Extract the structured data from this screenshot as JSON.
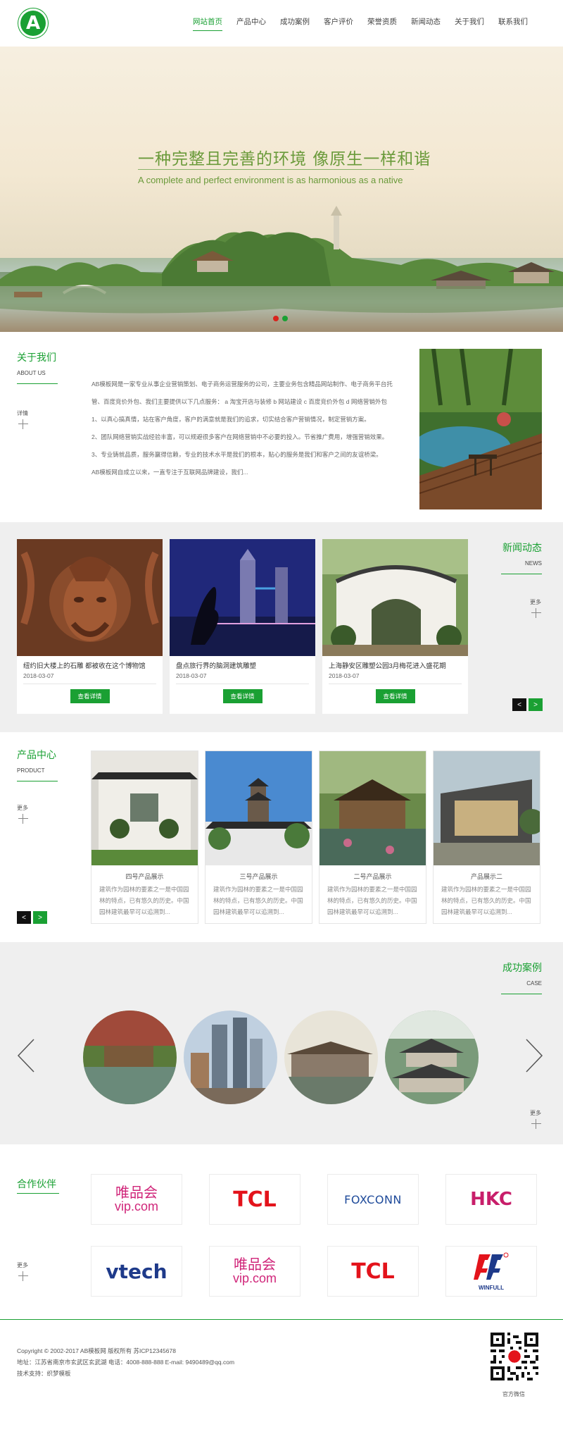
{
  "nav": {
    "logo_letter": "A",
    "items": [
      "网站首页",
      "产品中心",
      "成功案例",
      "客户评价",
      "荣誉资质",
      "新闻动态",
      "关于我们",
      "联系我们"
    ],
    "active_index": 0
  },
  "banner": {
    "title": "一种完整且完善的环境  像原生一样和谐",
    "subtitle": "A complete and perfect environment is as harmonious as a native",
    "dot_colors": [
      "#d8231c",
      "#1aa033"
    ]
  },
  "about": {
    "title_cn": "关于我们",
    "title_en": "ABOUT US",
    "more": "详情",
    "paragraphs": [
      "AB模板网是一家专业从事企业营销策划、电子商务运营服务的公司，主要业务包含精品网站制作、电子商务平台托管、百度竞价外包、我们主要提供以下几点服务： a 淘宝开店与装修 b 网站建设 c 百度竞价外包 d 网络营销外包 1、以真心搞真情，站在客户角度，客户的满意就是我们的追求，切实结合客户营销情况，制定营销方案。",
      "2、团队网络营销实战经验丰富，可以规避很多客户在网络营销中不必要的投入。节省推广费用，增强营销效果。",
      "3、专业铸就品质，服务赢得信赖，专业的技术水平是我们的根本，贴心的服务是我们和客户之间的友谊桥梁。",
      "AB模板网自成立以来，一直专注于互联网品牌建设，我们..."
    ]
  },
  "news": {
    "title_cn": "新闻动态",
    "title_en": "NEWS",
    "more": "更多",
    "button_label": "查看详情",
    "items": [
      {
        "title": "纽约旧大楼上的石雕 都被收在这个博物馆",
        "date": "2018-03-07"
      },
      {
        "title": "盘点旅行界的脑洞建筑雕塑",
        "date": "2018-03-07"
      },
      {
        "title": "上海静安区雕塑公园3月梅花进入盛花期",
        "date": "2018-03-07"
      }
    ],
    "prev": "<",
    "next": ">"
  },
  "products": {
    "title_cn": "产品中心",
    "title_en": "PRODUCT",
    "more": "更多",
    "prev": "<",
    "next": ">",
    "items": [
      {
        "title": "四号产品展示",
        "desc": "建筑作为园林的要素之一是中国园林的特点，已有悠久的历史。中国园林建筑最早可以追溯到..."
      },
      {
        "title": "三号产品展示",
        "desc": "建筑作为园林的要素之一是中国园林的特点，已有悠久的历史。中国园林建筑最早可以追溯到..."
      },
      {
        "title": "二号产品展示",
        "desc": "建筑作为园林的要素之一是中国园林的特点，已有悠久的历史。中国园林建筑最早可以追溯到..."
      },
      {
        "title": "产品展示二",
        "desc": "建筑作为园林的要素之一是中国园林的特点，已有悠久的历史。中国园林建筑最早可以追溯到..."
      }
    ]
  },
  "cases": {
    "title_cn": "成功案例",
    "title_en": "CASE",
    "more": "更多"
  },
  "partners": {
    "title": "合作伙伴",
    "more": "更多",
    "logos": [
      {
        "name": "唯品会",
        "sub": "vip.com"
      },
      {
        "name": "TCL"
      },
      {
        "name": "FOXCONN"
      },
      {
        "name": "HKC"
      },
      {
        "name": "vtech"
      },
      {
        "name": "唯品会",
        "sub": "vip.com"
      },
      {
        "name": "TCL"
      },
      {
        "name": "WINFULL"
      }
    ]
  },
  "footer": {
    "copyright": "Copyright © 2002-2017 AB模板网 版权所有 苏ICP12345678",
    "address": "地址：江苏省南京市玄武区玄武湖    电话：4008-888-888    E-mail: 9490489@qq.com",
    "support": "技术支持：织梦模板",
    "qr_label": "官方微信"
  },
  "colors": {
    "accent": "#1aa033",
    "gray_section": "#efefef"
  }
}
